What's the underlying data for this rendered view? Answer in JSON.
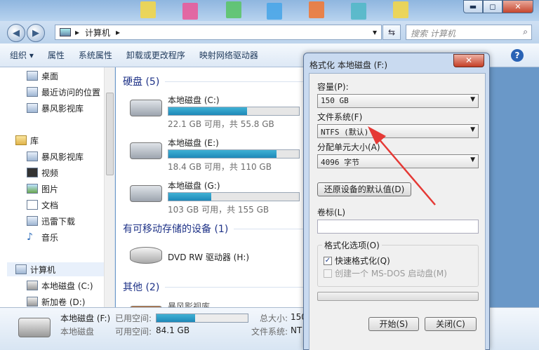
{
  "window": {
    "minimize": "▬",
    "maximize": "◻",
    "close": "✕"
  },
  "nav": {
    "back": "◀",
    "forward": "▶",
    "path_arrow": "▸",
    "path": "计算机",
    "path_end": "▸",
    "dropdown": "▾",
    "refresh": "⇆",
    "search_placeholder": "搜索 计算机",
    "search_icon": "⌕"
  },
  "toolbar": {
    "items": [
      "组织 ▾",
      "属性",
      "系统属性",
      "卸载或更改程序",
      "映射网络驱动器"
    ],
    "help": "?"
  },
  "sidebar": {
    "items": [
      {
        "label": "桌面",
        "icon": "desktop-icon"
      },
      {
        "label": "最近访问的位置",
        "icon": "recent-icon"
      },
      {
        "label": "暴风影视库",
        "icon": "library-icon"
      },
      {
        "label": "库",
        "icon": "library-folder-icon"
      },
      {
        "label": "暴风影视库",
        "icon": "library-icon"
      },
      {
        "label": "视频",
        "icon": "video-icon"
      },
      {
        "label": "图片",
        "icon": "picture-icon"
      },
      {
        "label": "文档",
        "icon": "document-icon"
      },
      {
        "label": "迅雷下载",
        "icon": "download-icon"
      },
      {
        "label": "音乐",
        "icon": "music-icon"
      },
      {
        "label": "计算机",
        "icon": "computer-icon"
      },
      {
        "label": "本地磁盘 (C:)",
        "icon": "drive-icon"
      },
      {
        "label": "新加卷 (D:)",
        "icon": "drive-icon"
      }
    ]
  },
  "main": {
    "groups": [
      "硬盘 (5)",
      "有可移动存储的设备 (1)",
      "其他 (2)"
    ],
    "drives": [
      {
        "name": "本地磁盘 (C:)",
        "info": "22.1 GB 可用，共 55.8 GB",
        "used": 0.6
      },
      {
        "name": "本地磁盘 (E:)",
        "info": "18.4 GB 可用，共 110 GB",
        "used": 0.83
      },
      {
        "name": "本地磁盘 (G:)",
        "info": "103 GB 可用，共 155 GB",
        "used": 0.33
      }
    ],
    "dvd": "DVD RW 驱动器 (H:)",
    "other_partial": "暴风影视库"
  },
  "status": {
    "name": "本地磁盘 (F:)",
    "type": "本地磁盘",
    "used_label": "已用空间:",
    "used_fraction": 0.42,
    "free_label": "可用空间:",
    "free_value": "84.1 GB",
    "total_label": "总大小:",
    "total_value": "150",
    "fs_label": "文件系统:",
    "fs_value": "NT"
  },
  "dialog": {
    "title": "格式化 本地磁盘 (F:)",
    "close": "✕",
    "capacity_label": "容量(P):",
    "capacity_value": "150 GB",
    "fs_label": "文件系统(F)",
    "fs_value": "NTFS (默认)",
    "alloc_label": "分配单元大小(A)",
    "alloc_value": "4096 字节",
    "restore_button": "还原设备的默认值(D)",
    "volume_label": "卷标(L)",
    "volume_value": "",
    "options_legend": "格式化选项(O)",
    "quick_format": "快速格式化(Q)",
    "quick_format_checked": true,
    "msdos": "创建一个 MS-DOS 启动盘(M)",
    "msdos_checked": false,
    "start_button": "开始(S)",
    "close_button": "关闭(C)",
    "combo_arrow": "▼"
  },
  "colors": {
    "accent": "#1e88b8",
    "annotation_arrow": "#e53935",
    "group_heading": "#1e3287"
  }
}
